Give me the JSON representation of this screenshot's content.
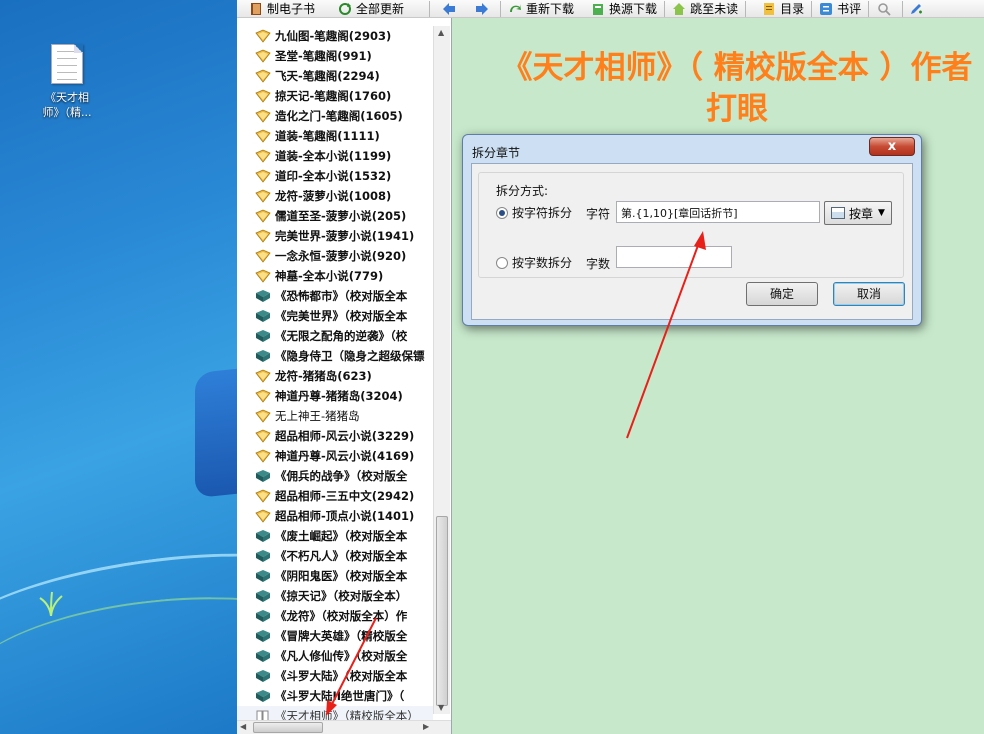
{
  "desktop": {
    "icon_label_line1": "《天才相",
    "icon_label_line2": "师》（精..."
  },
  "toolbar": {
    "make_ebook": "制电子书",
    "update_all": "全部更新",
    "redownload": "重新下载",
    "switch_source": "换源下载",
    "jump_unread": "跳至未读",
    "toc": "目录",
    "comments": "书评"
  },
  "chapter_list": [
    {
      "text": "九仙图-笔趣阁(2903)",
      "icon": "folder-icon"
    },
    {
      "text": "圣堂-笔趣阁(991)",
      "icon": "folder-icon"
    },
    {
      "text": "飞天-笔趣阁(2294)",
      "icon": "folder-icon"
    },
    {
      "text": "掠天记-笔趣阁(1760)",
      "icon": "folder-icon"
    },
    {
      "text": "造化之门-笔趣阁(1605)",
      "icon": "folder-icon"
    },
    {
      "text": "道装-笔趣阁(1111)",
      "icon": "folder-icon"
    },
    {
      "text": "道装-全本小说(1199)",
      "icon": "folder-icon"
    },
    {
      "text": "道印-全本小说(1532)",
      "icon": "folder-icon"
    },
    {
      "text": "龙符-菠萝小说(1008)",
      "icon": "folder-icon"
    },
    {
      "text": "儒道至圣-菠萝小说(205)",
      "icon": "folder-icon"
    },
    {
      "text": "完美世界-菠萝小说(1941)",
      "icon": "folder-icon"
    },
    {
      "text": "一念永恒-菠萝小说(920)",
      "icon": "folder-icon"
    },
    {
      "text": "神墓-全本小说(779)",
      "icon": "folder-icon"
    },
    {
      "text": "《恐怖都市》（校对版全本",
      "icon": "book-icon"
    },
    {
      "text": "《完美世界》（校对版全本",
      "icon": "book-icon"
    },
    {
      "text": "《无限之配角的逆袭》（校",
      "icon": "book-icon"
    },
    {
      "text": "《隐身侍卫（隐身之超级保镖",
      "icon": "book-icon"
    },
    {
      "text": "龙符-猪猪岛(623)",
      "icon": "folder-icon"
    },
    {
      "text": "神道丹尊-猪猪岛(3204)",
      "icon": "folder-icon"
    },
    {
      "text": "无上神王-猪猪岛",
      "icon": "folder-icon",
      "plain": true
    },
    {
      "text": "超品相师-风云小说(3229)",
      "icon": "folder-icon"
    },
    {
      "text": "神道丹尊-风云小说(4169)",
      "icon": "folder-icon"
    },
    {
      "text": "《佣兵的战争》（校对版全",
      "icon": "book-icon"
    },
    {
      "text": "超品相师-三五中文(2942)",
      "icon": "folder-icon"
    },
    {
      "text": "超品相师-顶点小说(1401)",
      "icon": "folder-icon"
    },
    {
      "text": "《废土崛起》（校对版全本",
      "icon": "book-icon"
    },
    {
      "text": "《不朽凡人》（校对版全本",
      "icon": "book-icon"
    },
    {
      "text": "《阴阳鬼医》（校对版全本",
      "icon": "book-icon"
    },
    {
      "text": "《掠天记》（校对版全本）",
      "icon": "book-icon"
    },
    {
      "text": "《龙符》（校对版全本）作",
      "icon": "book-icon"
    },
    {
      "text": "《冒牌大英雄》（精校版全",
      "icon": "book-icon"
    },
    {
      "text": "《凡人修仙传》（校对版全",
      "icon": "book-icon"
    },
    {
      "text": "《斗罗大陆》（校对版全本",
      "icon": "book-icon"
    },
    {
      "text": "《斗罗大陆II绝世唐门》（",
      "icon": "book-icon"
    },
    {
      "text": "《天才相师》（精校版全本）",
      "icon": "open-book-icon",
      "selected": true
    }
  ],
  "reading": {
    "title_line1": "《天才相师》（ 精校版全本 ）作者",
    "title_line2": "打眼"
  },
  "dialog": {
    "title": "拆分章节",
    "close": "x",
    "split_method_label": "拆分方式:",
    "option_by_char": "按字符拆分",
    "char_label": "字符",
    "char_value": "第.{1,10}[章回话折节]",
    "dropdown_label": "按章",
    "option_by_count": "按字数拆分",
    "count_label": "字数",
    "count_value": "",
    "ok": "确定",
    "cancel": "取消"
  },
  "colors": {
    "title_orange": "#ff7f1a",
    "reading_bg": "#c7e8cb",
    "annotation_arrow": "#e8201a"
  }
}
